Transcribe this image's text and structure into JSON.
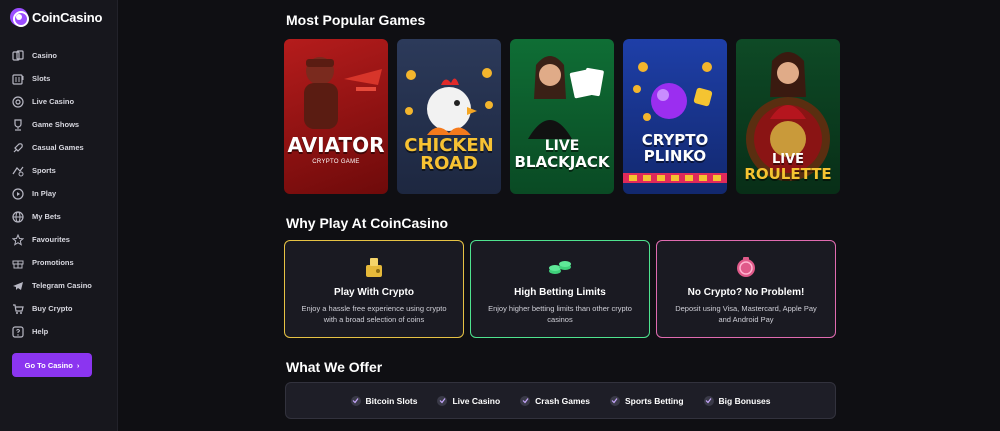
{
  "brand": {
    "name": "CoinCasino"
  },
  "sidebar": {
    "items": [
      {
        "label": "Casino",
        "icon": "cards-icon"
      },
      {
        "label": "Slots",
        "icon": "slot-machine-icon"
      },
      {
        "label": "Live Casino",
        "icon": "chip-icon"
      },
      {
        "label": "Game Shows",
        "icon": "trophy-icon"
      },
      {
        "label": "Casual Games",
        "icon": "rocket-icon"
      },
      {
        "label": "Sports",
        "icon": "sports-icon"
      },
      {
        "label": "In Play",
        "icon": "play-icon"
      },
      {
        "label": "My Bets",
        "icon": "globe-icon"
      },
      {
        "label": "Favourites",
        "icon": "star-icon"
      },
      {
        "label": "Promotions",
        "icon": "gift-icon"
      },
      {
        "label": "Telegram Casino",
        "icon": "telegram-icon"
      },
      {
        "label": "Buy Crypto",
        "icon": "cart-icon"
      },
      {
        "label": "Help",
        "icon": "help-icon"
      }
    ],
    "cta_label": "Go To Casino"
  },
  "popular": {
    "title": "Most Popular Games",
    "games": [
      {
        "title": "AVIATOR",
        "subtitle": "CRYPTO GAME"
      },
      {
        "title_line1": "CHICKEN",
        "title_line2": "ROAD"
      },
      {
        "title_line1": "LIVE",
        "title_line2": "BLACKJACK"
      },
      {
        "title_line1": "CRYPTO",
        "title_line2": "PLINKO"
      },
      {
        "title_line1": "LIVE",
        "title_line2": "ROULETTE"
      }
    ]
  },
  "why": {
    "title": "Why Play At CoinCasino",
    "cards": [
      {
        "title": "Play With Crypto",
        "desc": "Enjoy a hassle free experience using crypto with a broad selection of coins",
        "icon": "wallet-icon"
      },
      {
        "title": "High Betting Limits",
        "desc": "Enjoy higher betting limits than other crypto casinos",
        "icon": "coins-icon"
      },
      {
        "title": "No Crypto? No Problem!",
        "desc": "Deposit using Visa, Mastercard, Apple Pay and Android Pay",
        "icon": "piggy-bank-icon"
      }
    ]
  },
  "offer": {
    "title": "What We Offer",
    "items": [
      "Bitcoin Slots",
      "Live Casino",
      "Crash Games",
      "Sports Betting",
      "Big Bonuses"
    ]
  }
}
